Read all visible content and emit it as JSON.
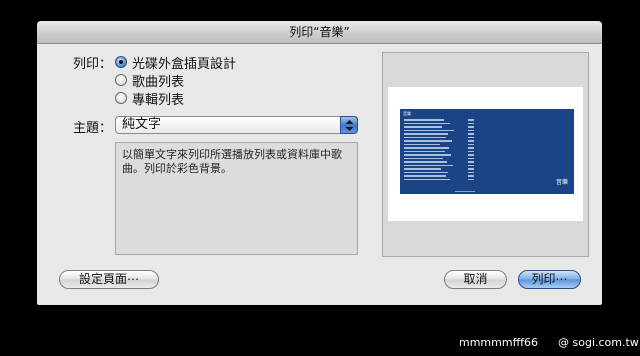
{
  "dialog": {
    "title": "列印“音樂”",
    "print_label": "列印：",
    "options": [
      {
        "label": "光碟外盒插頁設計",
        "selected": true
      },
      {
        "label": "歌曲列表",
        "selected": false
      },
      {
        "label": "專輯列表",
        "selected": false
      }
    ],
    "theme_label": "主題：",
    "theme_value": "純文字",
    "description": "以簡單文字來列印所選播放列表或資料庫中歌曲。列印於彩色背景。",
    "preview": {
      "cover_title": "音樂",
      "cover_brand": "音樂",
      "cover_color": "#1b4486"
    },
    "buttons": {
      "page_setup": "設定頁面⋯",
      "cancel": "取消",
      "print": "列印⋯"
    }
  },
  "watermark": {
    "left": "mmmmmfff66",
    "right": "@ sogi.com.tw"
  }
}
